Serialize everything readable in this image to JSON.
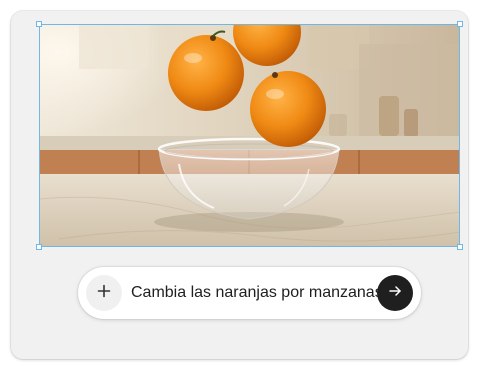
{
  "editor": {
    "image": {
      "subject": "oranges falling into a glass bowl on a kitchen counter",
      "orange_color": "#f08a14",
      "selection_color": "#6fb8e6"
    },
    "prompt": {
      "add_icon": "plus-icon",
      "text": "Cambia las naranjas por manzanas",
      "send_icon": "arrow-right-icon",
      "send_button_color": "#1f1f1f"
    }
  }
}
